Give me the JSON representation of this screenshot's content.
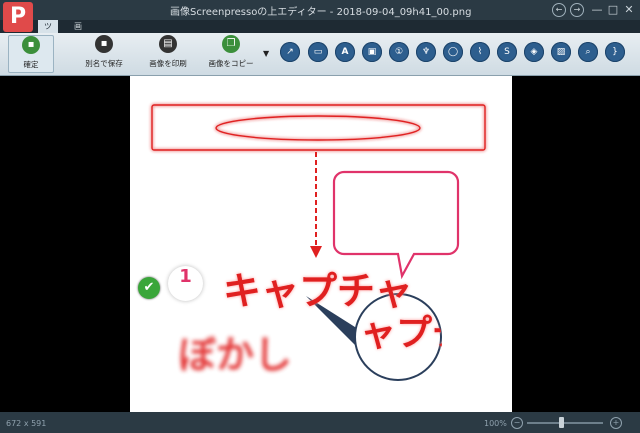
{
  "window": {
    "title": "画像Screenpressoの上エディター - 2018-09-04_09h41_00.png",
    "logo_glyph": "P",
    "back_glyph": "←",
    "forward_glyph": "→",
    "minimize_glyph": "—",
    "maximize_glyph": "□",
    "close_glyph": "✕"
  },
  "tabs": [
    {
      "label": "ツイ"
    },
    {
      "label": "画像"
    }
  ],
  "ribbon": {
    "buttons": [
      {
        "label": "確定",
        "icon": "save-icon",
        "glyph": "▪",
        "color": "#3b8f3b"
      },
      {
        "label": "別名で保存",
        "icon": "save-as-icon",
        "glyph": "▪",
        "color": "#333333"
      },
      {
        "label": "画像を印刷",
        "icon": "print-icon",
        "glyph": "▤",
        "color": "#333333"
      },
      {
        "label": "画像をコピー",
        "icon": "copy-icon",
        "glyph": "❐",
        "color": "#3b8f3b"
      }
    ],
    "dropdown_glyph": "▼",
    "tools": [
      {
        "name": "arrow-tool-icon",
        "glyph": "↗"
      },
      {
        "name": "rectangle-tool-icon",
        "glyph": "▭"
      },
      {
        "name": "text-tool-icon",
        "glyph": "A"
      },
      {
        "name": "callout-tool-icon",
        "glyph": "▣"
      },
      {
        "name": "step-tool-icon",
        "glyph": "①"
      },
      {
        "name": "highlight-tool-icon",
        "glyph": "♆"
      },
      {
        "name": "ellipse-tool-icon",
        "glyph": "◯"
      },
      {
        "name": "polyline-tool-icon",
        "glyph": "⌇"
      },
      {
        "name": "freehand-tool-icon",
        "glyph": "S"
      },
      {
        "name": "blur-tool-icon",
        "glyph": "◈"
      },
      {
        "name": "image-tool-icon",
        "glyph": "▨"
      },
      {
        "name": "magnifier-tool-icon",
        "glyph": "⌕"
      },
      {
        "name": "more-tools-icon",
        "glyph": "}"
      }
    ]
  },
  "canvas": {
    "step_number": "1",
    "caption_text": "キャプチャ",
    "magnified_text": "ャプチ",
    "blur_text": "ぼかし",
    "check_glyph": "✔"
  },
  "status": {
    "dimensions": "672 x 591",
    "zoom": "100%",
    "zoom_level": 0.45
  },
  "colors": {
    "annotation_red": "#e02020",
    "callout_pink": "#e0336a",
    "tool_blue": "#2d5e8e",
    "check_green": "#3aa63a"
  }
}
